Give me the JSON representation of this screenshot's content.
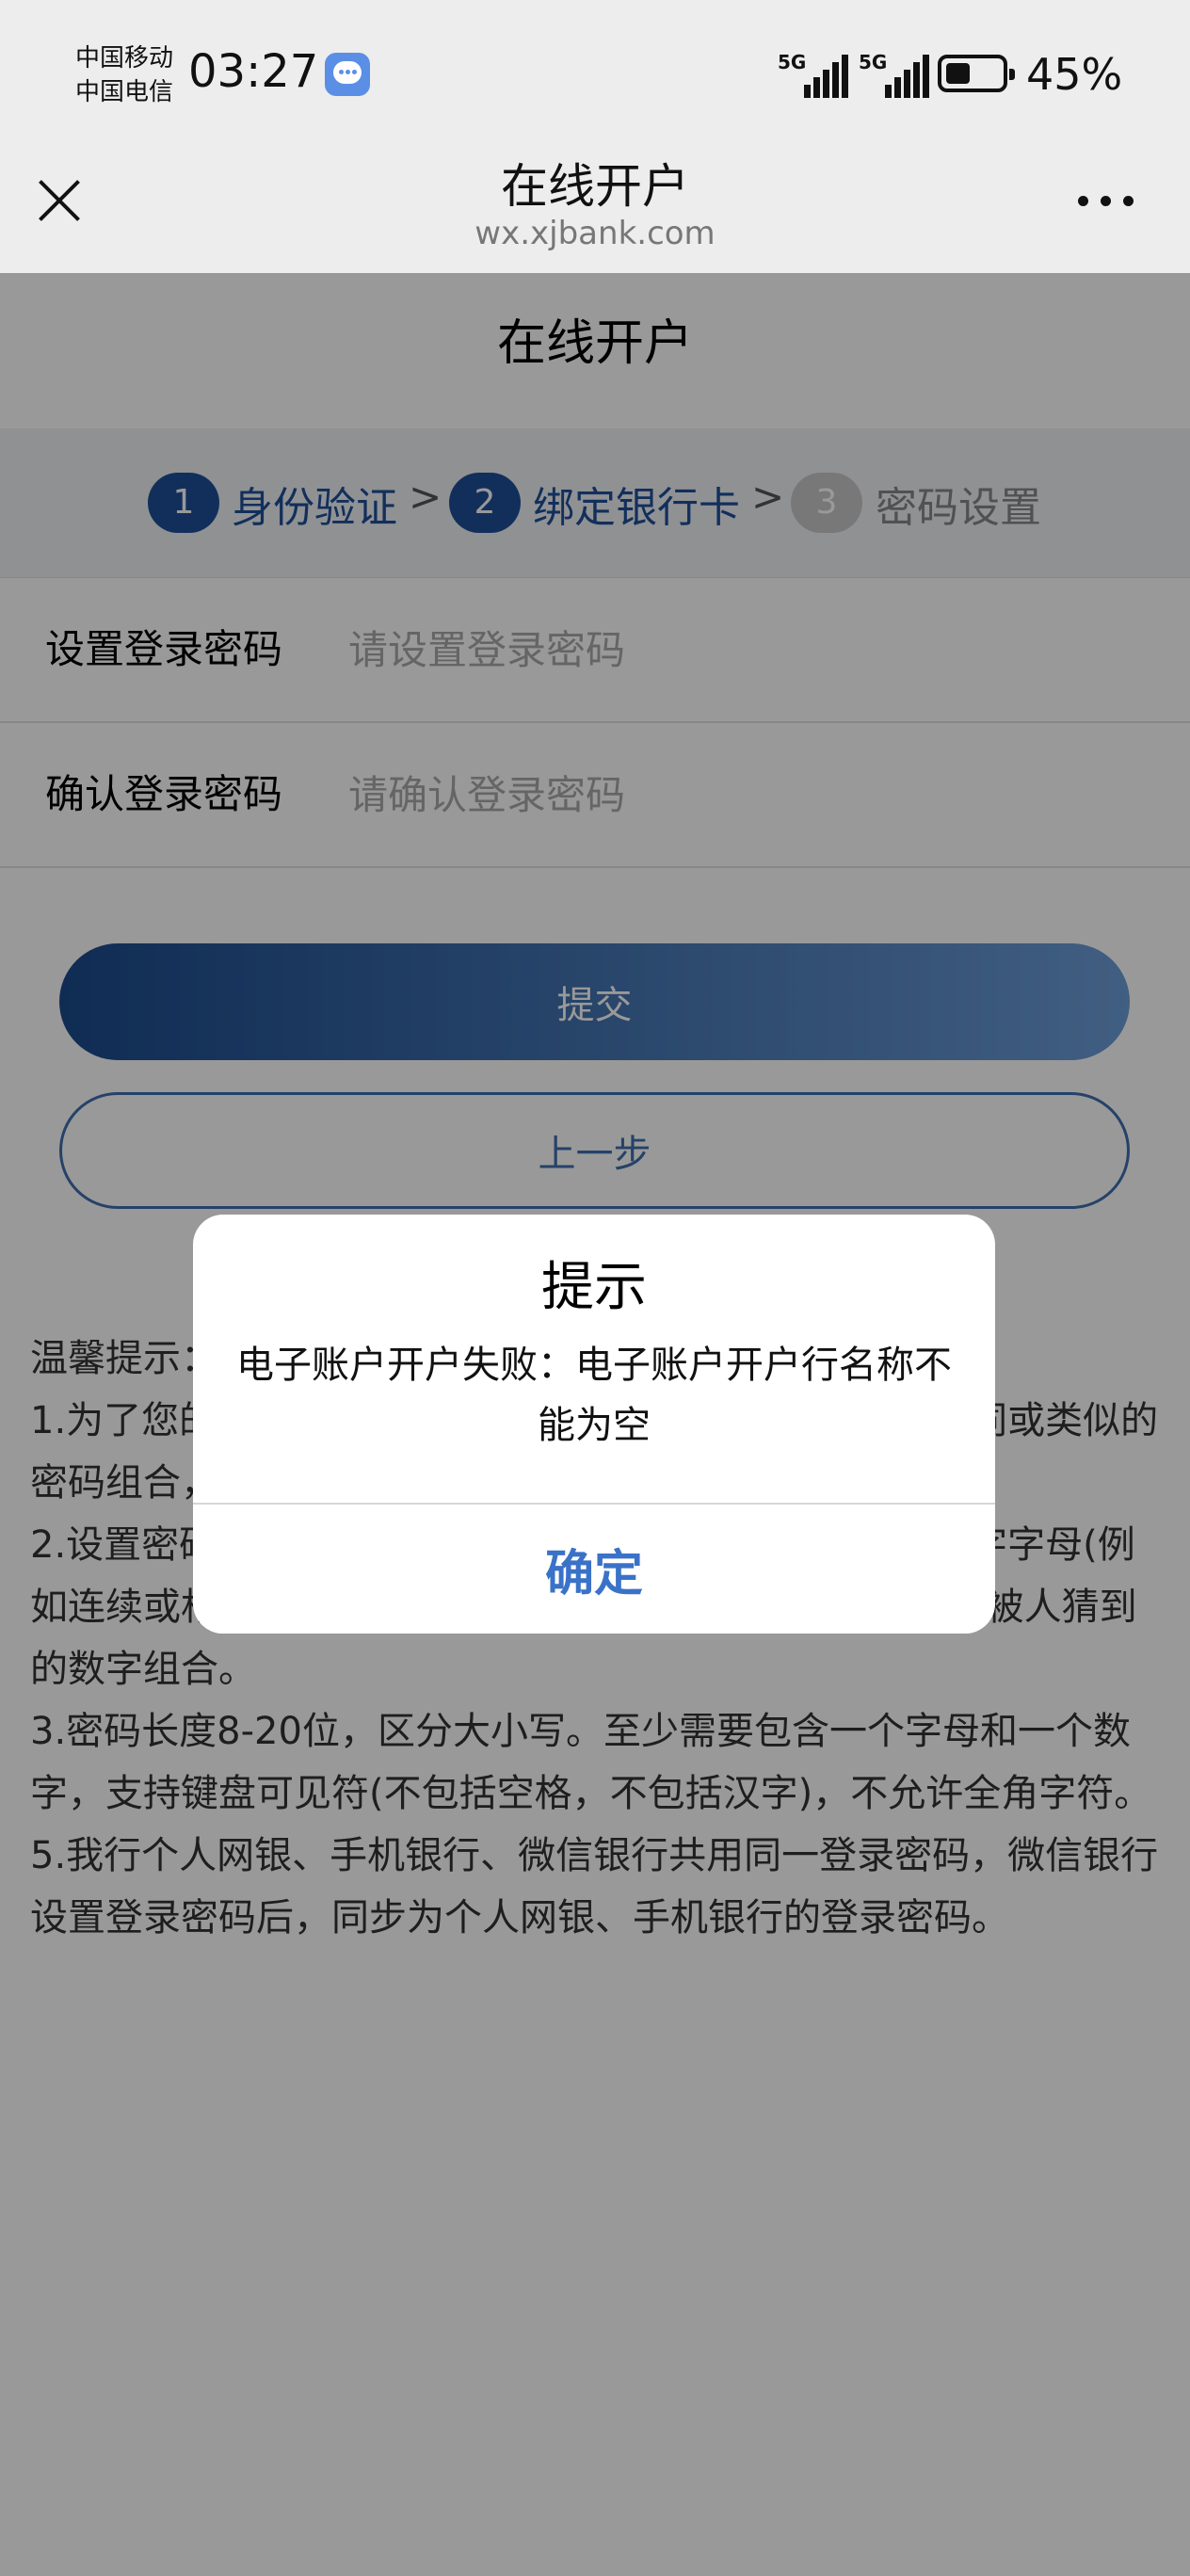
{
  "status_bar": {
    "carrier_1": "中国移动",
    "carrier_2": "中国电信",
    "time": "03:27",
    "signal_1_label": "5G",
    "signal_2_label": "5G",
    "battery_percent": "45%",
    "battery_level": 0.45
  },
  "nav": {
    "title": "在线开户",
    "url": "wx.xjbank.com",
    "close_icon": "close-icon",
    "more_icon": "more-icon"
  },
  "page": {
    "title": "在线开户",
    "steps": [
      {
        "number": "1",
        "label": "身份验证"
      },
      {
        "number": "2",
        "label": "绑定银行卡"
      },
      {
        "number": "3",
        "label": "密码设置"
      }
    ],
    "step_separator": ">",
    "fields": [
      {
        "label": "设置登录密码",
        "placeholder": "请设置登录密码",
        "value": ""
      },
      {
        "label": "确认登录密码",
        "placeholder": "请确认登录密码",
        "value": ""
      }
    ],
    "submit_label": "提交",
    "prev_label": "上一步",
    "tips": [
      "温馨提示：",
      "1.为了您的账户安全，建议不要使用与常用软件、网站相同或类似的密码组合，并建议您定期更换密码。",
      "2.设置密码时，建议不要使用生日、身份证号码、简单数字字母(例如连续或相同字母数字、递增顺序、常见单词短语)等容易被人猜到的数字组合。",
      "3.密码长度8-20位，区分大小写。至少需要包含一个字母和一个数字，支持键盘可见符(不包括空格，不包括汉字)，不允许全角字符。",
      "5.我行个人网银、手机银行、微信银行共用同一登录密码，微信银行设置登录密码后，同步为个人网银、手机银行的登录密码。"
    ]
  },
  "dialog": {
    "title": "提示",
    "message": "电子账户开户失败：电子账户开户行名称不能为空",
    "ok_label": "确定"
  },
  "colors": {
    "accent": "#1b4a8c",
    "step_active": "#1f4f9a",
    "step_inactive": "#c9c9c9",
    "dialog_button": "#3a72c8"
  }
}
